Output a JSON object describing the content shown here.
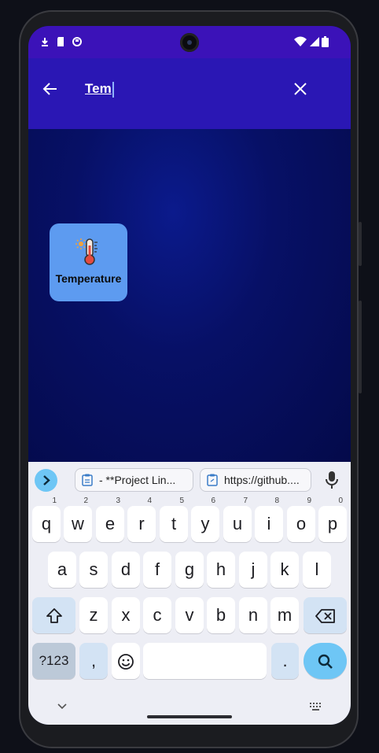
{
  "search": {
    "query": "Tem"
  },
  "results": [
    {
      "label": "Temperature",
      "icon": "thermometer-icon"
    }
  ],
  "keyboard": {
    "suggestions": [
      "- **Project Lin...",
      "https://github...."
    ],
    "row1": [
      "q",
      "w",
      "e",
      "r",
      "t",
      "y",
      "u",
      "i",
      "o",
      "p"
    ],
    "row1_hints": [
      "1",
      "2",
      "3",
      "4",
      "5",
      "6",
      "7",
      "8",
      "9",
      "0"
    ],
    "row2": [
      "a",
      "s",
      "d",
      "f",
      "g",
      "h",
      "j",
      "k",
      "l"
    ],
    "row3": [
      "z",
      "x",
      "c",
      "v",
      "b",
      "n",
      "m"
    ],
    "symbols_label": "?123",
    "comma": ",",
    "period": "."
  },
  "colors": {
    "statusbar": "#3b12b8",
    "searchbar": "#2a17b4",
    "tile": "#5d9bf0",
    "accent": "#6ec6f5"
  }
}
